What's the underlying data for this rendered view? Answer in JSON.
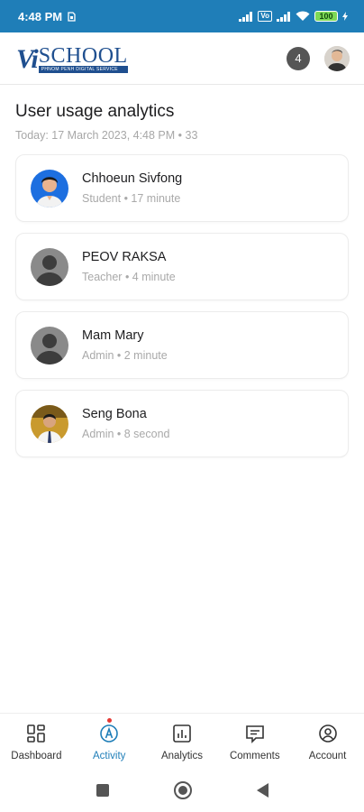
{
  "status_bar": {
    "time": "4:48 PM",
    "vo_label": "Vo",
    "battery": "100"
  },
  "header": {
    "logo_vi": "Vi",
    "logo_school": "SCHOOL",
    "logo_tagline": "PHNOM PENH DIGITAL SERVICE",
    "notification_count": "4"
  },
  "page": {
    "title": "User usage analytics",
    "subtitle": "Today: 17 March 2023, 4:48 PM • 33"
  },
  "users": [
    {
      "name": "Chhoeun Sivfong",
      "meta": "Student • 17 minute",
      "avatar": "photo-blue"
    },
    {
      "name": "PEOV RAKSA",
      "meta": "Teacher • 4 minute",
      "avatar": "default"
    },
    {
      "name": "Mam Mary",
      "meta": "Admin • 2 minute",
      "avatar": "default"
    },
    {
      "name": "Seng Bona",
      "meta": "Admin • 8 second",
      "avatar": "photo-gold"
    }
  ],
  "bottom_nav": [
    {
      "label": "Dashboard",
      "icon": "dashboard-icon",
      "active": false
    },
    {
      "label": "Activity",
      "icon": "activity-icon",
      "active": true
    },
    {
      "label": "Analytics",
      "icon": "analytics-icon",
      "active": false
    },
    {
      "label": "Comments",
      "icon": "comments-icon",
      "active": false
    },
    {
      "label": "Account",
      "icon": "account-icon",
      "active": false
    }
  ],
  "colors": {
    "status_bar": "#1f7eb8",
    "active_nav": "#1f7eb8",
    "brand": "#1f4f8f"
  }
}
